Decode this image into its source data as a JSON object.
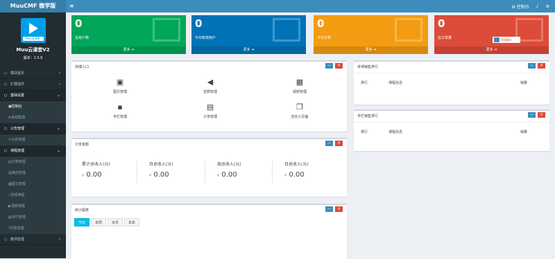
{
  "app": {
    "brand": "MuuCMF 微学版",
    "product": "Muu云课堂V2",
    "version": "版本：1.5.9",
    "logo_text": "Muu云课堂"
  },
  "topbar": {
    "console_label": "控制台"
  },
  "sidebar": {
    "items": [
      {
        "label": "模块首页",
        "chev": "‹"
      },
      {
        "label": "扩展插件",
        "chev": "‹"
      },
      {
        "label": "基础设置",
        "chev": "⌄"
      },
      {
        "label": "控制台",
        "sub": true,
        "active": true
      },
      {
        "label": "系统配置",
        "sub": true
      },
      {
        "label": "公告管理",
        "chev": "⌄"
      },
      {
        "label": "公告管理",
        "sub": true
      },
      {
        "label": "课程管理",
        "chev": "⌄"
      },
      {
        "label": "分类管理",
        "sub": true
      },
      {
        "label": "筛选管理",
        "sub": true
      },
      {
        "label": "图文管理",
        "sub": true
      },
      {
        "label": "音频课程",
        "sub": true
      },
      {
        "label": "视频课程",
        "sub": true
      },
      {
        "label": "专栏管理",
        "sub": true
      },
      {
        "label": "问答管理",
        "sub": true
      },
      {
        "label": "教师管理",
        "chev": "‹"
      }
    ]
  },
  "stats": [
    {
      "value": "0",
      "label": "总用户数",
      "more": "更多",
      "color": "#00a65a"
    },
    {
      "value": "0",
      "label": "今日新增用户",
      "more": "更多",
      "color": "#0073b7"
    },
    {
      "value": "0",
      "label": "今日订单",
      "more": "更多",
      "color": "#f39c12"
    },
    {
      "value": "0",
      "label": "总订单量",
      "more": "更多",
      "color": "#dd4b39"
    }
  ],
  "badge": {
    "label": "发现报价"
  },
  "quick": {
    "title": "快捷入口",
    "items": [
      {
        "label": "图文管理",
        "icon": "image-icon",
        "glyph": "▣"
      },
      {
        "label": "音频管理",
        "icon": "volume-icon",
        "glyph": "◀"
      },
      {
        "label": "视频管理",
        "icon": "film-icon",
        "glyph": "▦"
      },
      {
        "label": "专栏管理",
        "icon": "grid-icon",
        "glyph": "▪"
      },
      {
        "label": "订单管理",
        "icon": "newspaper-icon",
        "glyph": "▤"
      },
      {
        "label": "自定义页面",
        "icon": "copy-icon",
        "glyph": "❐"
      }
    ]
  },
  "revenue": {
    "title": "订单金额",
    "items": [
      {
        "label": "累计总收入(元)",
        "currency": "¥",
        "value": "0.00"
      },
      {
        "label": "月总收入(元)",
        "currency": "¥",
        "value": "0.00"
      },
      {
        "label": "周总收入(元)",
        "currency": "¥",
        "value": "0.00"
      },
      {
        "label": "日总收入(元)",
        "currency": "¥",
        "value": "0.00"
      }
    ]
  },
  "chart": {
    "title": "统计图表",
    "tabs": [
      "今日",
      "本周",
      "本月",
      "本年"
    ]
  },
  "rank1": {
    "title": "单课销售排行",
    "cols": [
      "排行",
      "课程信息",
      "销量"
    ]
  },
  "rank2": {
    "title": "专栏销售排行",
    "cols": [
      "排行",
      "课程信息",
      "销量"
    ]
  }
}
